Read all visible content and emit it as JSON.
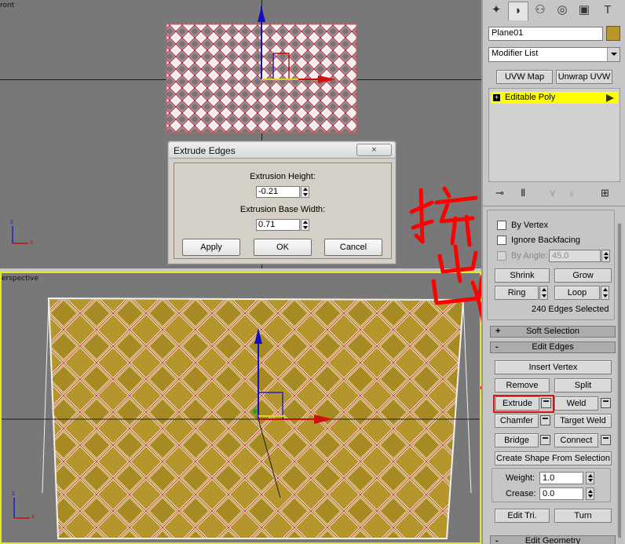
{
  "viewports": {
    "front_label": "ront",
    "perspective_label": "erspective",
    "axis_x": "x",
    "axis_z": "z"
  },
  "annotation": {
    "text": "挤出",
    "color": "#ff0000"
  },
  "dialog": {
    "title": "Extrude Edges",
    "close_icon": "×",
    "extrusion_height_label": "Extrusion Height:",
    "extrusion_height_value": "-0.21",
    "extrusion_base_width_label": "Extrusion Base Width:",
    "extrusion_base_width_value": "0.71",
    "apply_label": "Apply",
    "ok_label": "OK",
    "cancel_label": "Cancel"
  },
  "panel": {
    "tabs": [
      "create-icon",
      "modify-icon",
      "hierarchy-icon",
      "motion-icon",
      "display-icon",
      "utilities-icon"
    ],
    "object_name": "Plane01",
    "object_color": "#b8962c",
    "modifier_list": "Modifier List",
    "uvw_map_label": "UVW Map",
    "unwrap_uvw_label": "Unwrap UVW",
    "stack_item": "Editable Poly",
    "stack_highlight": "#ffff00",
    "by_vertex_label": "By Vertex",
    "ignore_backfacing_label": "Ignore Backfacing",
    "by_angle_label": "By Angle:",
    "by_angle_value": "45.0",
    "shrink_label": "Shrink",
    "grow_label": "Grow",
    "ring_label": "Ring",
    "loop_label": "Loop",
    "selection_status": "240 Edges Selected",
    "soft_selection_label": "Soft Selection",
    "soft_selection_sign": "+",
    "edit_edges_label": "Edit Edges",
    "edit_edges_sign": "-",
    "insert_vertex_label": "Insert Vertex",
    "remove_label": "Remove",
    "split_label": "Split",
    "extrude_label": "Extrude",
    "weld_label": "Weld",
    "chamfer_label": "Chamfer",
    "target_weld_label": "Target Weld",
    "bridge_label": "Bridge",
    "connect_label": "Connect",
    "create_shape_label": "Create Shape From Selection",
    "weight_label": "Weight:",
    "weight_value": "1.0",
    "crease_label": "Crease:",
    "crease_value": "0.0",
    "edit_tri_label": "Edit Tri.",
    "turn_label": "Turn",
    "edit_geometry_label": "Edit Geometry",
    "edit_geometry_sign": "-"
  }
}
